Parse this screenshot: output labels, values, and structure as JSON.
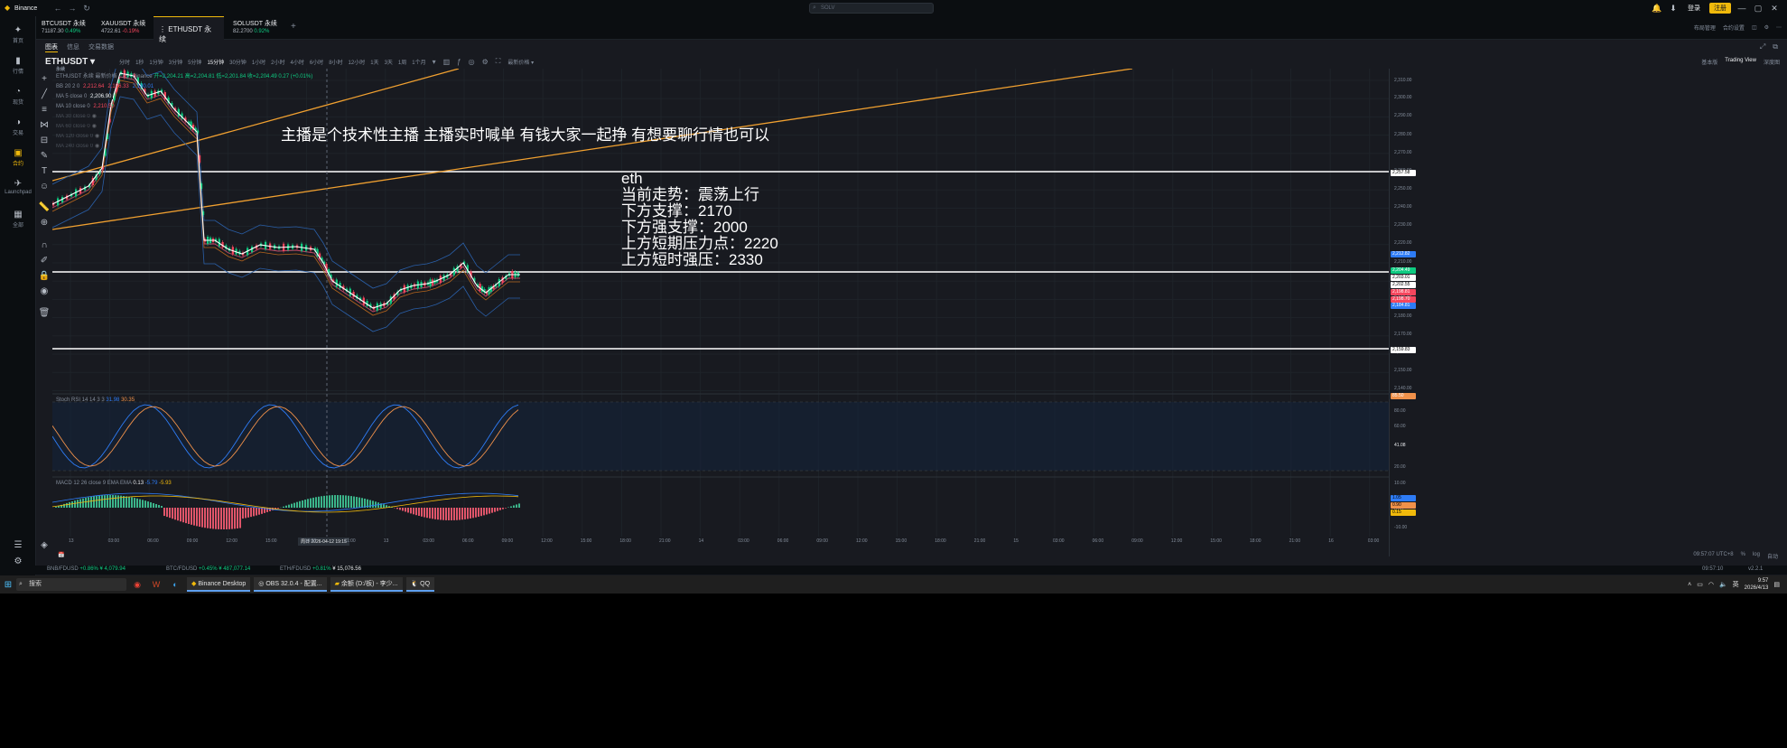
{
  "app": {
    "title": "Binance",
    "search_placeholder": "SOLV",
    "login": "登录",
    "register": "注册",
    "links": [
      "布局管理",
      "合约设置"
    ]
  },
  "sidebar": {
    "items": [
      {
        "label": "首页",
        "icon": "home-icon",
        "glyph": "✦"
      },
      {
        "label": "行情",
        "icon": "chart-icon",
        "glyph": "▮"
      },
      {
        "label": "现货",
        "icon": "spot-icon",
        "glyph": "◔"
      },
      {
        "label": "交易",
        "icon": "trade-icon",
        "glyph": "◑"
      },
      {
        "label": "合约",
        "icon": "futures-icon",
        "glyph": "▣",
        "active": true
      },
      {
        "label": "Launchpad",
        "icon": "rocket-icon",
        "glyph": "✈"
      },
      {
        "label": "全部",
        "icon": "grid-icon",
        "glyph": "▦"
      }
    ]
  },
  "symbol_tabs": [
    {
      "name": "BTCUSDT 永续",
      "price": "71187.30",
      "change": "0.49%",
      "dir": "up"
    },
    {
      "name": "XAUUSDT 永续",
      "price": "4722.61",
      "change": "-0.19%",
      "dir": "dn"
    },
    {
      "name": "ETHUSDT 永续",
      "active": true
    },
    {
      "name": "SOLUSDT 永续",
      "price": "82.2700",
      "change": "0.92%",
      "dir": "up"
    }
  ],
  "subtabs": [
    "图表",
    "信息",
    "交易数据"
  ],
  "toolbar": {
    "symbol": "ETHUSDT",
    "symbol_sub": "永续",
    "intervals": [
      "分时",
      "1秒",
      "1分钟",
      "3分钟",
      "5分钟",
      "15分钟",
      "30分钟",
      "1小时",
      "2小时",
      "4小时",
      "6小时",
      "8小时",
      "12小时",
      "1天",
      "3天",
      "1周",
      "1个月"
    ],
    "active_interval": "15分钟",
    "price_type": "最新价格",
    "views": [
      "基本版",
      "Trading View",
      "深度图"
    ],
    "active_view": "Trading View"
  },
  "legend": {
    "header": "ETHUSDT 永续 最新价格 · 15 · Binance",
    "ohlc": "开=2,204.21 高=2,204.81 低=2,201.84 收=2,204.49 0.27 (+0.01%)",
    "rows": [
      {
        "label": "BB 20 2 0",
        "values": [
          "2,212.64",
          "2,196.33",
          "2,180.01"
        ]
      },
      {
        "label": "MA 5 close 0",
        "value": "2,206.90",
        "highlight": true
      },
      {
        "label": "MA 10 close 0",
        "value": "2,210.50"
      },
      {
        "label": "MA 30 close 0",
        "value": ""
      },
      {
        "label": "MA 60 close 0",
        "value": ""
      },
      {
        "label": "MA 120 close 0",
        "value": ""
      },
      {
        "label": "MA 240 close 0",
        "value": ""
      }
    ]
  },
  "overlay": {
    "banner": "主播是个技术性主播 主播实时喊单 有钱大家一起挣 有想要聊行情也可以",
    "lines": [
      "eth",
      "当前走势：震荡上行",
      "下方支撑：2170",
      "下方强支撑：2000",
      "上方短期压力点：2220",
      "上方短时强压：2330"
    ]
  },
  "y_axis": {
    "ticks": [
      "2,310.00",
      "2,300.00",
      "2,290.00",
      "2,280.00",
      "2,270.00",
      "2,260.00",
      "2,250.00",
      "2,240.00",
      "2,230.00",
      "2,220.00",
      "2,210.00",
      "2,200.00",
      "2,190.00",
      "2,180.00",
      "2,170.00",
      "2,160.00",
      "2,150.00",
      "2,140.00"
    ],
    "tags": [
      {
        "text": "2,257.58",
        "bg": "#ffffff",
        "fg": "#000000"
      },
      {
        "text": "2,212.82",
        "bg": "#2e7cf6",
        "fg": "#ffffff"
      },
      {
        "text": "2,204.49",
        "bg": "#0ecb81",
        "fg": "#ffffff"
      },
      {
        "text": "2,203.01",
        "bg": "#ffffff",
        "fg": "#000000"
      },
      {
        "text": "2,202.55",
        "bg": "#ffffff",
        "fg": "#000000"
      },
      {
        "text": "2,198.81",
        "bg": "#f6465d",
        "fg": "#ffffff"
      },
      {
        "text": "2,198.70",
        "bg": "#f6465d",
        "fg": "#ffffff"
      },
      {
        "text": "2,184.81",
        "bg": "#2e7cf6",
        "fg": "#ffffff"
      },
      {
        "text": "2,159.83",
        "bg": "#ffffff",
        "fg": "#000000"
      }
    ]
  },
  "stoch": {
    "label": "Stoch RSI 14 14 3 3",
    "k": "31.98",
    "d": "30.35",
    "ticks": [
      "80.00",
      "60.00",
      "20.00"
    ],
    "tag_top": "85.50",
    "tag_mid": "41.08"
  },
  "macd": {
    "label": "MACD 12 26 close 9 EMA EMA",
    "v1": "0.13",
    "v2": "-5.79",
    "v3": "-5.93",
    "ticks": [
      "10.00",
      "0.00",
      "-10.00"
    ],
    "tags": [
      "1.05",
      "0.90",
      "0.15"
    ]
  },
  "x_axis": {
    "ticks": [
      "13",
      "03:00",
      "06:00",
      "09:00",
      "12:00",
      "15:00",
      "18:00",
      "21:00",
      "13",
      "03:00",
      "06:00",
      "09:00",
      "12:00",
      "15:00",
      "18:00",
      "21:00",
      "14",
      "03:00",
      "06:00",
      "09:00",
      "12:00",
      "15:00",
      "18:00",
      "21:00",
      "15",
      "03:00",
      "06:00",
      "09:00",
      "12:00",
      "15:00",
      "18:00",
      "21:00",
      "16",
      "03:00"
    ],
    "cursor": "周日 2026-04-12  19:15"
  },
  "bottom": {
    "time": "09:57:07 UTC+8",
    "options": [
      "%",
      "log",
      "自动"
    ]
  },
  "status": [
    {
      "pair": "BNB/FDUSD",
      "chg": "+0.86%",
      "price": "¥ 4,079.94",
      "dir": "up"
    },
    {
      "pair": "BTC/FDUSD",
      "chg": "+0.45%",
      "price": "¥ 487,077.14",
      "dir": "up"
    },
    {
      "pair": "ETH/FDUSD",
      "chg": "+0.81%",
      "price": "¥ 15,076.56",
      "dir": "up"
    }
  ],
  "status_right": [
    "09:57:10",
    "v2.2.1"
  ],
  "taskbar": {
    "search": "搜索",
    "apps": [
      "Binance Desktop",
      "OBS 32.0.4 - 配置...",
      "余额 (D:/板) - 李少...",
      "QQ"
    ],
    "ime": "英",
    "time": "9:57",
    "date": "2026/4/13"
  }
}
